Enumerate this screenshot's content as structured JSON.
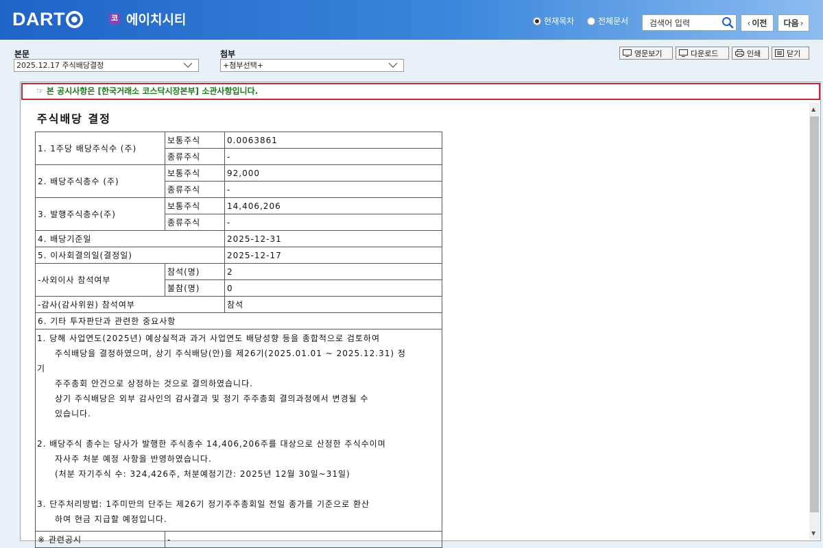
{
  "header": {
    "logo_text": "DART",
    "market_badge": "코",
    "company_name": "에이치시티",
    "radio_current": "현재목차",
    "radio_all": "전체문서",
    "search_placeholder": "검색어 입력",
    "prev_label": "이전",
    "next_label": "다음"
  },
  "toolbar": {
    "body_label": "본문",
    "body_select_value": "2025.12.17  주식배당결정",
    "attach_label": "첨부",
    "attach_select_value": "+첨부선택+",
    "buttons": [
      "영문보기",
      "다운로드",
      "인쇄",
      "닫기"
    ]
  },
  "notice_text": "☞ 본 공시사항은 [한국거래소 코스닥시장본부] 소관사항입니다.",
  "document": {
    "title": "주식배당 결정",
    "rows": {
      "r1_label": "1. 1주당 배당주식수 (주)",
      "r1_common_label": "보통주식",
      "r1_common_value": "0.0063861",
      "r1_pref_label": "종류주식",
      "r1_pref_value": "-",
      "r2_label": "2. 배당주식총수 (주)",
      "r2_common_label": "보통주식",
      "r2_common_value": "92,000",
      "r2_pref_label": "종류주식",
      "r2_pref_value": "-",
      "r3_label": "3. 발행주식총수(주)",
      "r3_common_label": "보통주식",
      "r3_common_value": "14,406,206",
      "r3_pref_label": "종류주식",
      "r3_pref_value": "-",
      "r4_label": "4. 배당기준일",
      "r4_value": "2025-12-31",
      "r5_label": "5. 이사회결의일(결정일)",
      "r5_value": "2025-12-17",
      "outside_label": "-사외이사 참석여부",
      "attend_label": "참석(명)",
      "attend_value": "2",
      "absent_label": "불참(명)",
      "absent_value": "0",
      "auditor_label": "-감사(감사위원) 참석여부",
      "auditor_value": "참석",
      "r6_label": "6. 기타 투자판단과 관련한 중요사항",
      "related_label": "※ 관련공시",
      "related_value": "-"
    },
    "notes": {
      "p1_l1": "1. 당해 사업연도(2025년) 예상실적과 과거 사업연도 배당성향 등을 종합적으로 검토하여",
      "p1_l2": "주식배당을 결정하였으며, 상기 주식배당(안)을 제26기(2025.01.01 ~ 2025.12.31) 정",
      "p1_l3": "기",
      "p1_l4": "주주총회 안건으로 상정하는 것으로 결의하였습니다.",
      "p1_l5": "상기 주식배당은 외부 감사인의 감사결과 및 정기 주주총회 결의과정에서 변경될 수",
      "p1_l6": "있습니다.",
      "p2_l1": "2. 배당주식 총수는 당사가 발행한 주식총수 14,406,206주를 대상으로 산정한 주식수이며",
      "p2_l2": "자사주 처분 예정 사항을 반영하였습니다.",
      "p2_l3": "(처분 자기주식 수: 324,426주, 처분예정기간: 2025년 12월 30일~31일)",
      "p3_l1": "3. 단주처리방법: 1주미만의 단주는 제26기 정기주주총회일 전일 종가를 기준으로 환산",
      "p3_l2": "하여 현금 지급할 예정입니다."
    }
  }
}
